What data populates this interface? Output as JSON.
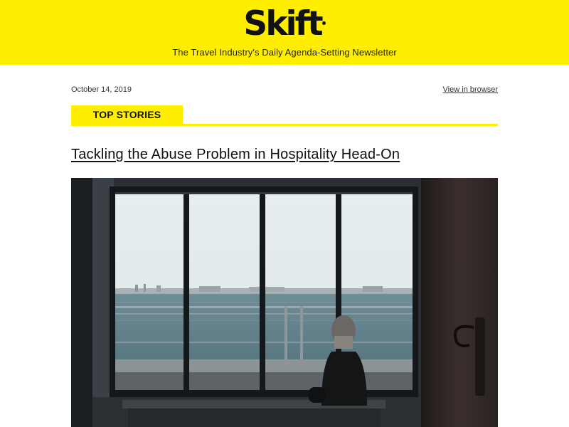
{
  "header": {
    "logo_text": "Skift",
    "tagline": "The Travel Industry's Daily Agenda-Setting Newsletter",
    "background_color": "#ffee00"
  },
  "meta": {
    "date": "October 14, 2019",
    "view_in_browser": "View in browser"
  },
  "section": {
    "label": "TOP STORIES",
    "accent_color": "#ffee00"
  },
  "story": {
    "headline": "Tackling the Abuse Problem in Hospitality Head-On",
    "image_icon": "hero-photo-window-sea"
  }
}
